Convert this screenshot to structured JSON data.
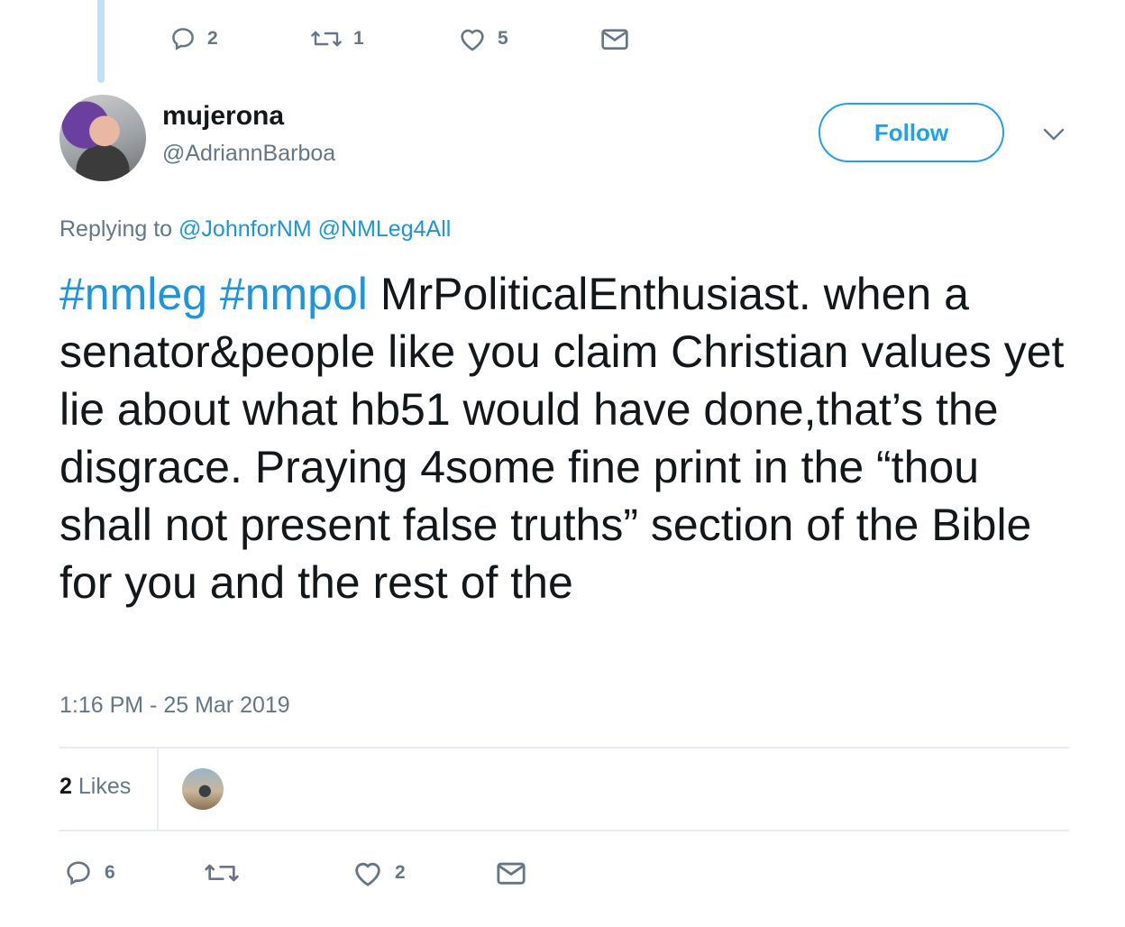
{
  "parent_actions": {
    "replies": "2",
    "retweets": "1",
    "likes": "5"
  },
  "author": {
    "display_name": "mujerona",
    "handle": "@AdriannBarboa"
  },
  "follow_label": "Follow",
  "replying": {
    "prefix": "Replying to",
    "mentions": [
      "@JohnforNM",
      "@NMLeg4All"
    ]
  },
  "tweet": {
    "hashtags": [
      "#nmleg",
      "#nmpol"
    ],
    "body": "MrPoliticalEnthusiast. when a senator&people like you claim Christian values yet lie about what hb51 would have done,that’s the disgrace. Praying 4some fine print in the “thou shall not present false truths” section of the Bible for you and the rest of the"
  },
  "timestamp": "1:16 PM - 25 Mar 2019",
  "likes_summary": {
    "count": "2",
    "label": "Likes"
  },
  "actions": {
    "replies": "6",
    "retweets": "",
    "likes": "2"
  },
  "colors": {
    "link": "#1b95e0",
    "follow": "#1da1f2",
    "muted": "#657786",
    "thread_line": "#c4dff6"
  },
  "icons": [
    "reply-icon",
    "retweet-icon",
    "like-icon",
    "message-icon",
    "chevron-down-icon"
  ]
}
